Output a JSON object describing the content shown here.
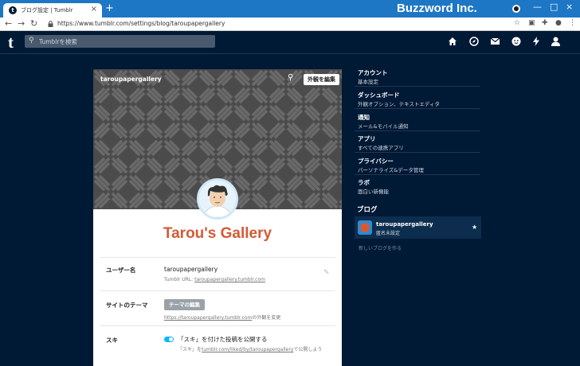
{
  "browser": {
    "tab_title": "ブログ設定 | Tumblr",
    "tab_favicon": "t",
    "new_tab": "+",
    "url": "https://www.tumblr.com/settings/blog/taroupapergallery",
    "watermark": "Buzzword Inc."
  },
  "header": {
    "logo": "t",
    "search_placeholder": "Tumblrを検索"
  },
  "card": {
    "cover_name": "taroupapergallery",
    "edit_look_label": "外観を編集",
    "blog_title": "Tarou's Gallery",
    "rows": {
      "username": {
        "label": "ユーザー名",
        "value": "taroupapergallery",
        "sub_prefix": "Tumblr URL: ",
        "sub_link": "taroupapergallery.tumblr.com"
      },
      "theme": {
        "label": "サイトのテーマ",
        "button": "テーマの編集",
        "sub_link": "https://taroupapergallery.tumblr.com",
        "sub_suffix": "の外観を変更"
      },
      "likes": {
        "label": "スキ",
        "value": "「スキ」を付けた投稿を公開する",
        "sub_prefix": "「スキ」を",
        "sub_link": "tumblr.com/liked/by/taroupapergallery",
        "sub_suffix": "で公開しよう"
      }
    }
  },
  "sidebar": {
    "items": [
      {
        "title": "アカウント",
        "desc": "基本設定"
      },
      {
        "title": "ダッシュボード",
        "desc": "外観オプション、テキストエディタ"
      },
      {
        "title": "通知",
        "desc": "メール&モバイル通知"
      },
      {
        "title": "アプリ",
        "desc": "すべての連携アプリ"
      },
      {
        "title": "プライバシー",
        "desc": "パーソナライズ&データ管理"
      },
      {
        "title": "ラボ",
        "desc": "面白い新機能"
      }
    ],
    "blog_heading": "ブログ",
    "blog": {
      "name": "taroupapergallery",
      "sub": "匿名未設定"
    },
    "new_blog": "新しいブログを作る"
  },
  "colors": {
    "background": "#001935",
    "accent": "#00b8ff",
    "title": "#d45a36"
  }
}
